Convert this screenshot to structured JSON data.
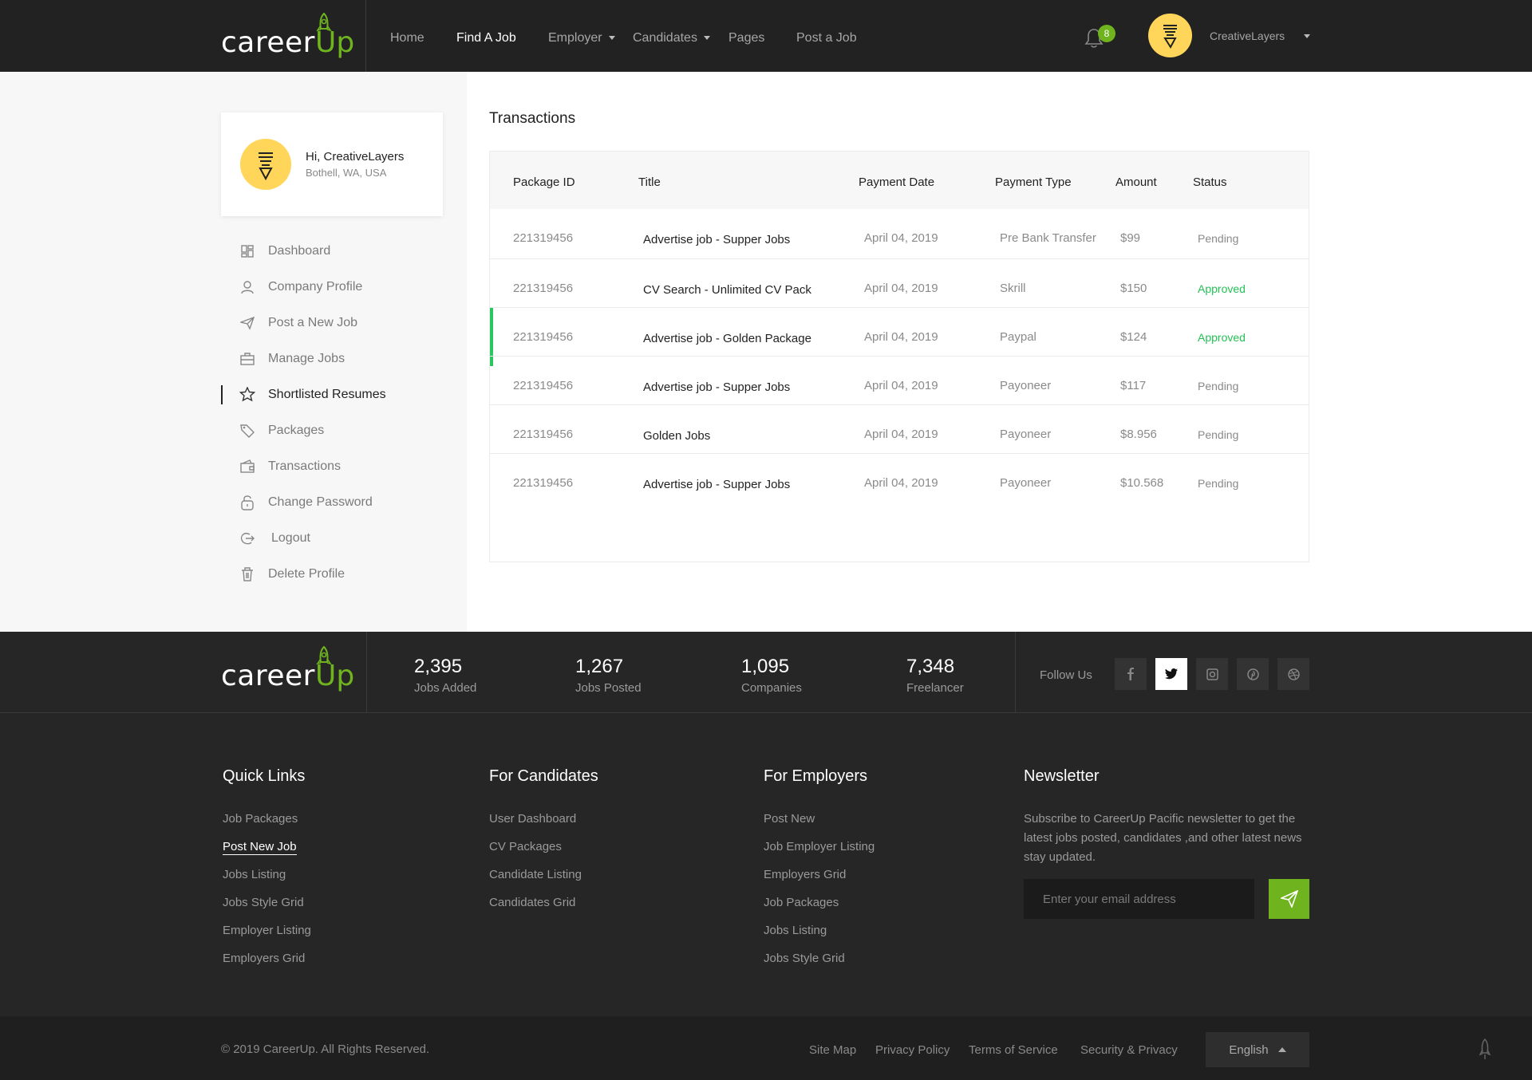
{
  "brand": {
    "name_part1": "career",
    "name_part2": "Up",
    "accent": "#6fb31f"
  },
  "header": {
    "nav": [
      {
        "label": "Home",
        "active": false,
        "dropdown": false
      },
      {
        "label": "Find A Job",
        "active": true,
        "dropdown": false
      },
      {
        "label": "Employer",
        "active": false,
        "dropdown": true
      },
      {
        "label": "Candidates",
        "active": false,
        "dropdown": true
      },
      {
        "label": "Pages",
        "active": false,
        "dropdown": false
      },
      {
        "label": "Post a Job",
        "active": false,
        "dropdown": false
      }
    ],
    "notification_count": "8",
    "user_name": "CreativeLayers"
  },
  "sidebar": {
    "greeting": "Hi, CreativeLayers",
    "location": "Bothell, WA, USA",
    "items": [
      {
        "label": "Dashboard",
        "icon": "dashboard-icon"
      },
      {
        "label": "Company Profile",
        "icon": "user-icon"
      },
      {
        "label": "Post a New Job",
        "icon": "paper-plane-icon"
      },
      {
        "label": "Manage Jobs",
        "icon": "briefcase-icon"
      },
      {
        "label": "Shortlisted Resumes",
        "icon": "star-badge-icon",
        "active": true
      },
      {
        "label": "Packages",
        "icon": "tag-icon"
      },
      {
        "label": "Transactions",
        "icon": "wallet-icon"
      },
      {
        "label": "Change Password",
        "icon": "lock-icon"
      },
      {
        "label": "Logout",
        "icon": "logout-icon"
      },
      {
        "label": "Delete Profile",
        "icon": "trash-icon"
      }
    ]
  },
  "main": {
    "title": "Transactions",
    "columns": [
      "Package ID",
      "Title",
      "Payment Date",
      "Payment Type",
      "Amount",
      "Status"
    ],
    "rows": [
      {
        "id": "221319456",
        "title": "Advertise job - Supper Jobs",
        "date": "April 04, 2019",
        "type": "Pre Bank Transfer",
        "amount": "$99",
        "status": "Pending",
        "highlight": false
      },
      {
        "id": "221319456",
        "title": "CV Search - Unlimited CV Pack",
        "date": "April 04, 2019",
        "type": "Skrill",
        "amount": "$150",
        "status": "Approved",
        "highlight": false
      },
      {
        "id": "221319456",
        "title": "Advertise job - Golden Package",
        "date": "April 04, 2019",
        "type": "Paypal",
        "amount": "$124",
        "status": "Approved",
        "highlight": true
      },
      {
        "id": "221319456",
        "title": "Advertise job - Supper Jobs",
        "date": "April 04, 2019",
        "type": "Payoneer",
        "amount": "$117",
        "status": "Pending",
        "highlight": false
      },
      {
        "id": "221319456",
        "title": "Golden Jobs",
        "date": "April 04, 2019",
        "type": "Payoneer",
        "amount": "$8.956",
        "status": "Pending",
        "highlight": false
      },
      {
        "id": "221319456",
        "title": "Advertise job - Supper Jobs",
        "date": "April 04, 2019",
        "type": "Payoneer",
        "amount": "$10.568",
        "status": "Pending",
        "highlight": false
      }
    ],
    "status_colors": {
      "Approved": "#23c255",
      "Pending": "#8a8a8a"
    }
  },
  "stats": [
    {
      "value": "2,395",
      "label": "Jobs Added"
    },
    {
      "value": "1,267",
      "label": "Jobs Posted"
    },
    {
      "value": "1,095",
      "label": "Companies"
    },
    {
      "value": "7,348",
      "label": "Freelancer"
    }
  ],
  "social": {
    "label": "Follow Us",
    "icons": [
      "facebook-icon",
      "twitter-icon",
      "instagram-icon",
      "pinterest-icon",
      "dribbble-icon"
    ]
  },
  "footer": {
    "quick_links": {
      "title": "Quick Links",
      "links": [
        "Job Packages",
        "Post New Job",
        "Jobs Listing",
        "Jobs Style Grid",
        "Employer Listing",
        "Employers Grid"
      ],
      "active_index": 1
    },
    "for_candidates": {
      "title": "For Candidates",
      "links": [
        "User Dashboard",
        "CV Packages",
        "Candidate Listing",
        "Candidates Grid"
      ]
    },
    "for_employers": {
      "title": "For Employers",
      "links": [
        "Post New",
        "Job Employer Listing",
        "Employers Grid",
        "Job Packages",
        "Jobs Listing",
        "Jobs Style Grid"
      ]
    },
    "newsletter": {
      "title": "Newsletter",
      "text": "Subscribe to CareerUp Pacific newsletter to get the latest jobs posted, candidates ,and other latest news stay updated.",
      "placeholder": "Enter your email address"
    }
  },
  "bottom": {
    "copyright": "© 2019 CareerUp. All Rights Reserved.",
    "links": [
      "Site Map",
      "Privacy Policy",
      "Terms of Service",
      "Security & Privacy"
    ],
    "language": "English"
  }
}
